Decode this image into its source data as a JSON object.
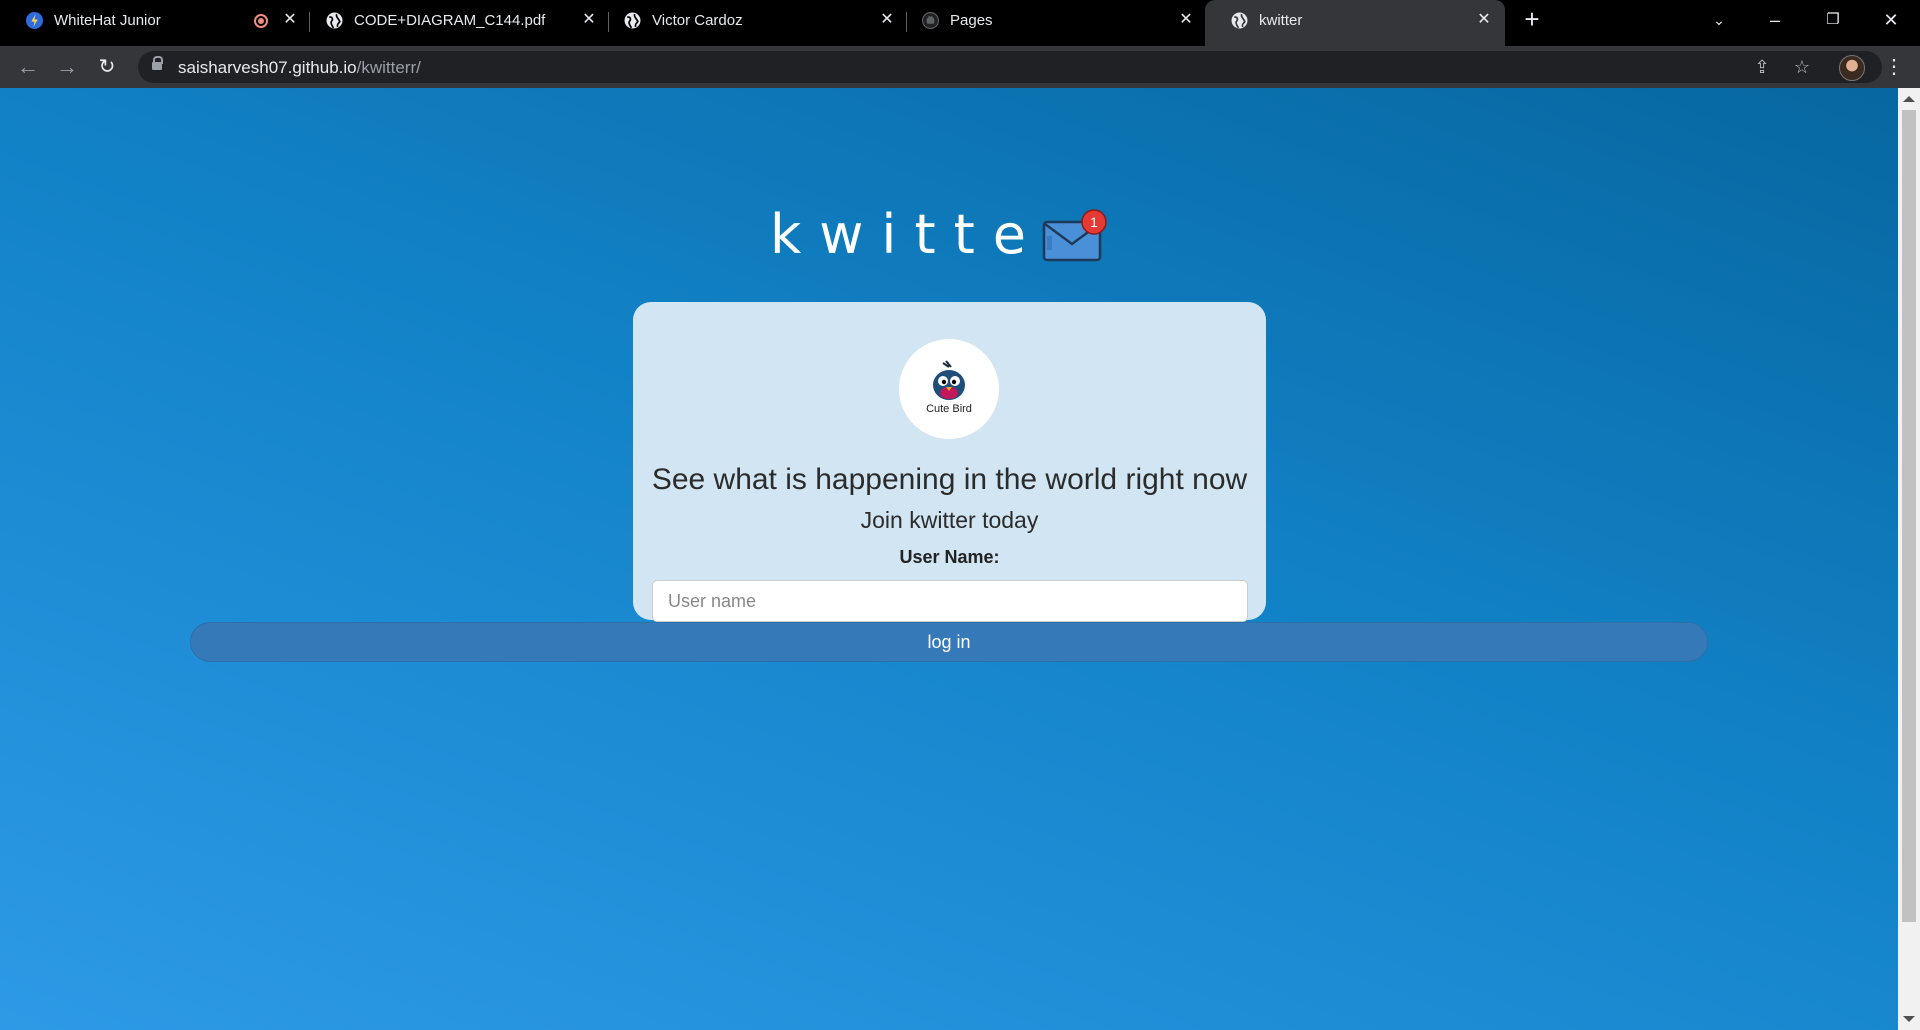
{
  "browser": {
    "tabs": [
      {
        "title": "WhiteHat Junior",
        "recording": true,
        "active": false
      },
      {
        "title": "CODE+DIAGRAM_C144.pdf",
        "active": false
      },
      {
        "title": "Victor Cardoz",
        "active": false
      },
      {
        "title": "Pages",
        "active": false
      },
      {
        "title": "kwitter",
        "active": true
      }
    ],
    "url": {
      "host": "saisharvesh07.github.io",
      "path": "/kwitterr/"
    }
  },
  "page": {
    "brand_title": "kwitter",
    "notification_count": "1",
    "logo_label": "Cute Bird",
    "headline": "See what is happening in the world right now",
    "subline": "Join kwitter today",
    "username_label": "User Name:",
    "username_placeholder": "User name",
    "username_value": "",
    "login_label": "log in"
  },
  "colors": {
    "page_gradient_top": "#0767a0",
    "page_gradient_bottom": "#2e9ae7",
    "card_bg": "#d1e5f2",
    "button_bg": "#3679b9",
    "badge_red": "#e53935"
  }
}
